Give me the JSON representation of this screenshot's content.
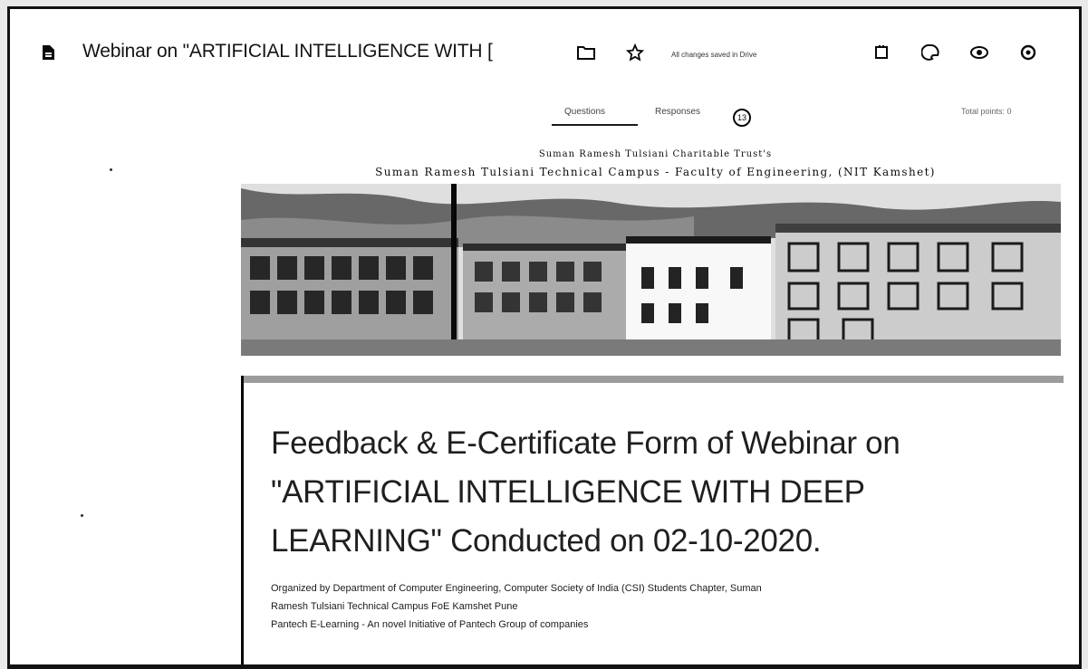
{
  "topbar": {
    "doc_title": "Webinar on \"ARTIFICIAL INTELLIGENCE WITH [",
    "save_status": "All changes saved in Drive",
    "icons": [
      "document-icon",
      "folder-icon",
      "star-icon",
      "palette-icon",
      "preview-eye-icon",
      "settings-icon",
      "addon-icon"
    ]
  },
  "tabs": {
    "questions": "Questions",
    "responses": "Responses",
    "responses_count": "13",
    "total_points": "Total points: 0"
  },
  "header_image": {
    "trust_line": "Suman Ramesh Tulsiani Charitable Trust's",
    "campus_line": "Suman Ramesh Tulsiani Technical Campus - Faculty of Engineering, (NIT Kamshet)"
  },
  "form": {
    "title": "Feedback & E-Certificate Form of Webinar on \"ARTIFICIAL INTELLIGENCE WITH DEEP LEARNING\" Conducted on 02-10-2020.",
    "description_line1": "Organized by Department of Computer Engineering, Computer Society of India (CSI) Students Chapter, Suman",
    "description_line2": "Ramesh Tulsiani Technical Campus FoE Kamshet Pune",
    "description_line3": "Pantech E-Learning - An novel Initiative of Pantech Group of companies"
  },
  "colors": {
    "accent": "#111111",
    "background": "#fdfdfd"
  }
}
